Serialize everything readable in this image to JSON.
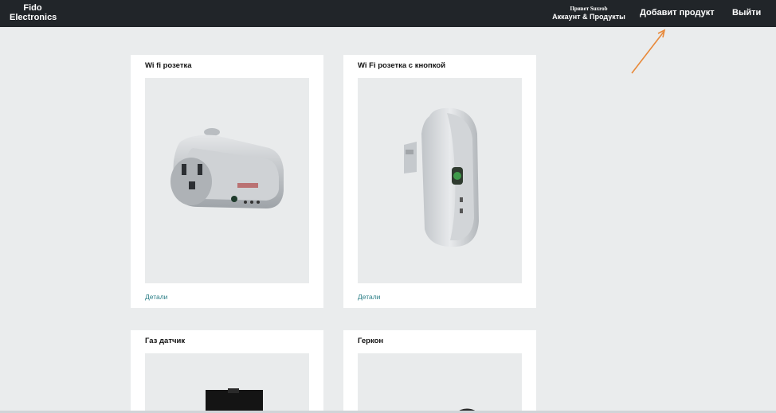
{
  "header": {
    "brand": "Fido Electronics",
    "greeting": "Привет Suxrob",
    "account_label": "Аккаунт & Продукты",
    "add_product_label": "Добавит продукт",
    "logout_label": "Выйти"
  },
  "products": [
    {
      "title": "Wi fi розетка",
      "details_label": "Детали"
    },
    {
      "title": "Wi Fi розетка с кнопкой",
      "details_label": "Детали"
    },
    {
      "title": "Газ датчик"
    },
    {
      "title": "Геркон"
    }
  ],
  "colors": {
    "navbar": "#212529",
    "page_background": "#eaeced",
    "link": "#2a7e86",
    "annotation_arrow": "#e8893a"
  }
}
